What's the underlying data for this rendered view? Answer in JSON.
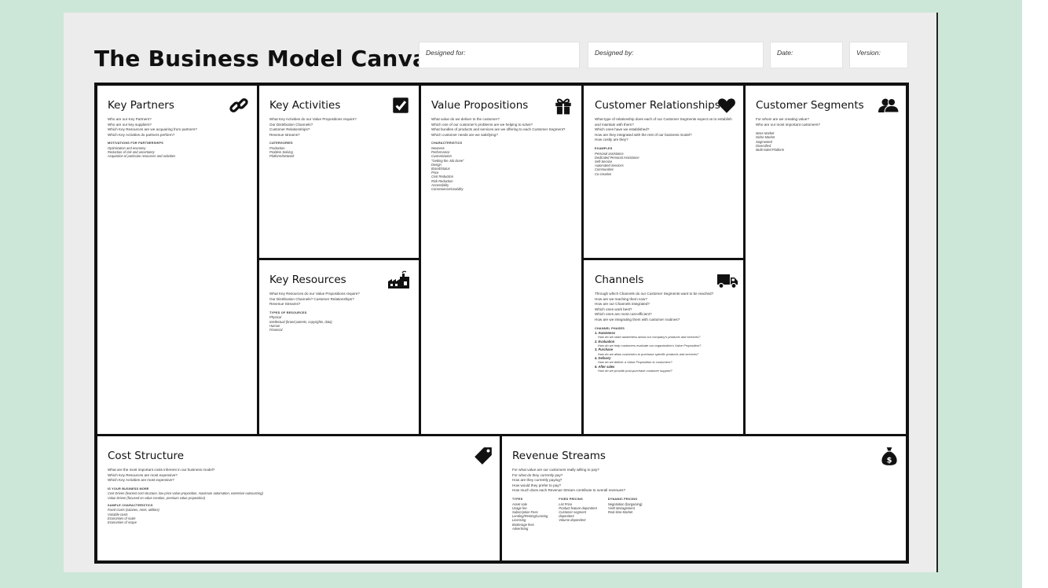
{
  "title": "The Business Model Canvas",
  "meta_fields": {
    "designed_for": "Designed for:",
    "designed_by": "Designed by:",
    "date": "Date:",
    "version": "Version:"
  },
  "blocks": {
    "key_partners": {
      "title": "Key Partners",
      "icon": "chain-link-icon",
      "questions": [
        "Who are our Key Partners?",
        "Who are our key suppliers?",
        "Which Key Resources are we acquairing from partners?",
        "Which Key Activities do partners perform?"
      ],
      "section": "Motivations for partnerships",
      "items": [
        "Optimization and economy",
        "Reduction of risk and uncertainty",
        "Acquisition of particular resources and activities"
      ]
    },
    "key_activities": {
      "title": "Key Activities",
      "icon": "checkbox-icon",
      "questions": [
        "What Key Activities do our Value Propositions require?",
        "Our Distribution Channels?",
        "Customer Relationships?",
        "Revenue streams?"
      ],
      "section": "Catergories",
      "items": [
        "Production",
        "Problem Solving",
        "Platform/Network"
      ]
    },
    "key_resources": {
      "title": "Key Resources",
      "icon": "factory-icon",
      "questions": [
        "What Key Resources do our Value Propositions require?",
        "Our Distribution Channels? Customer Relationships?",
        "Revenue Streams?"
      ],
      "section": "Types of resources",
      "items": [
        "Physical",
        "Intellectual (brand patents, copyrights, data)",
        "Human",
        "Financial"
      ]
    },
    "value_propositions": {
      "title": "Value Propositions",
      "icon": "gift-icon",
      "questions": [
        "What value do we deliver to the customer?",
        "Which one of our customer's problems are we helping to solve?",
        "What bundles of products and services are we offering to each Customer Segment?",
        "Which customer needs are we satisfying?"
      ],
      "section": "Characteristics",
      "items": [
        "Newness",
        "Performance",
        "Customization",
        "\"Getting the Job Done\"",
        "Design",
        "Brand/Status",
        "Price",
        "Cost Reduction",
        "Risk Reduction",
        "Accessibility",
        "Convenience/Usability"
      ]
    },
    "customer_relationships": {
      "title": "Customer Relationships",
      "icon": "heart-icon",
      "questions": [
        "What type of relationship does each of our Customer Segments expect us to establish and maintain with them?",
        "Which ones have we established?",
        "How are they integrated with the rest of our business model?",
        "How costly are they?"
      ],
      "section": "Examples",
      "items": [
        "Personal assistance",
        "Dedicated Personal Assistance",
        "Self-Service",
        "Automated Services",
        "Communities",
        "Co-creation"
      ]
    },
    "channels": {
      "title": "Channels",
      "icon": "delivery-truck-icon",
      "questions": [
        "Through which Channels do our Customer Segments want to be reached?",
        "How are we reaching them now?",
        "How are our Channels integrated?",
        "Which ones work best?",
        "Which ones are most cost-efficient?",
        "How are we integrating them with customer routines?"
      ],
      "section": "Channel phases",
      "phases": [
        {
          "name": "1. Awareness",
          "detail": "How do we raise awareness about our company's products and services?"
        },
        {
          "name": "2. Evaluation",
          "detail": "How do we help customers evaluate our organization's Value Proposition?"
        },
        {
          "name": "3. Purchase",
          "detail": "How do we allow customers to purchase specific products and services?"
        },
        {
          "name": "4. Delivery",
          "detail": "How do we deliver a Value Proposition to customers?"
        },
        {
          "name": "5. After sales",
          "detail": "How do we provide post-purchase customer support?"
        }
      ]
    },
    "customer_segments": {
      "title": "Customer Segments",
      "icon": "people-icon",
      "questions": [
        "For whom are we creating value?",
        "Who are our most important customers?"
      ],
      "items": [
        "Mass Market",
        "Niche Market",
        "Segmented",
        "Diversified",
        "Multi-sided Platform"
      ]
    },
    "cost_structure": {
      "title": "Cost Structure",
      "icon": "price-tag-icon",
      "questions": [
        "What are the most important costs inherent in our business model?",
        "Which Key Resources are most expensive?",
        "Which Key Activities are most expensive?"
      ],
      "section": "Is your business more",
      "items": [
        "Cost Driven (leanest cost structure, low price value proposition, maximum automation, extensive outsourcing)",
        "Value Driven (focused on value creation, premium value proposition)"
      ],
      "section2": "Sample characteristics",
      "items2": [
        "Fixed Costs (salaries, rents, utilities)",
        "Variable costs",
        "Economies of scale",
        "Economies of scope"
      ]
    },
    "revenue_streams": {
      "title": "Revenue Streams",
      "icon": "money-bag-icon",
      "questions": [
        "For what value are our customers really willing to pay?",
        "For what do they currently pay?",
        "How are they currently paying?",
        "How would they prefer to pay?",
        "How much does each Revenue Stream contribute to overall revenues?"
      ],
      "columns": [
        {
          "heading": "Types",
          "items": [
            "Asset sale",
            "Usage fee",
            "Subscription Fees",
            "Lending/Renting/Leasing",
            "Licensing",
            "Brokerage fees",
            "Advertising"
          ]
        },
        {
          "heading": "Fixed pricing",
          "items": [
            "List Price",
            "Product feature dependent",
            "Customer segment",
            "dependent",
            "Volume dependent"
          ]
        },
        {
          "heading": "Dynamic pricing",
          "items": [
            "Negotiation (bargaining)",
            "Yield Management",
            "Real-time-Market"
          ]
        }
      ]
    }
  }
}
